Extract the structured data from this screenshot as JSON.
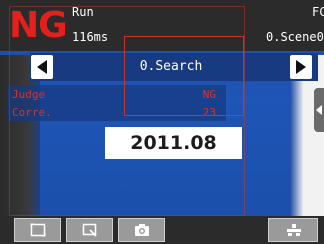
{
  "status": {
    "result": "NG",
    "mode": "Run",
    "processing_time": "116ms",
    "flow_label": "FC",
    "scene": "0.Scene0"
  },
  "navigation": {
    "current_item": "0.Search",
    "prev_icon": "left-arrow-icon",
    "next_icon": "right-arrow-icon"
  },
  "results": {
    "judge_label": "Judge",
    "judge_value": "NG",
    "corre_label": "Corre.",
    "corre_value": "23"
  },
  "image": {
    "date_text": "2011.08"
  },
  "toolbar": {
    "buttons": [
      {
        "icon": "fit-screen-icon"
      },
      {
        "icon": "zoom-icon"
      },
      {
        "icon": "camera-icon"
      },
      {
        "icon": "tool-menu-icon"
      }
    ]
  },
  "colors": {
    "ng_red": "#e3201c",
    "scene_blue": "#1e55b6",
    "bar_dark": "#2b2b2b"
  }
}
